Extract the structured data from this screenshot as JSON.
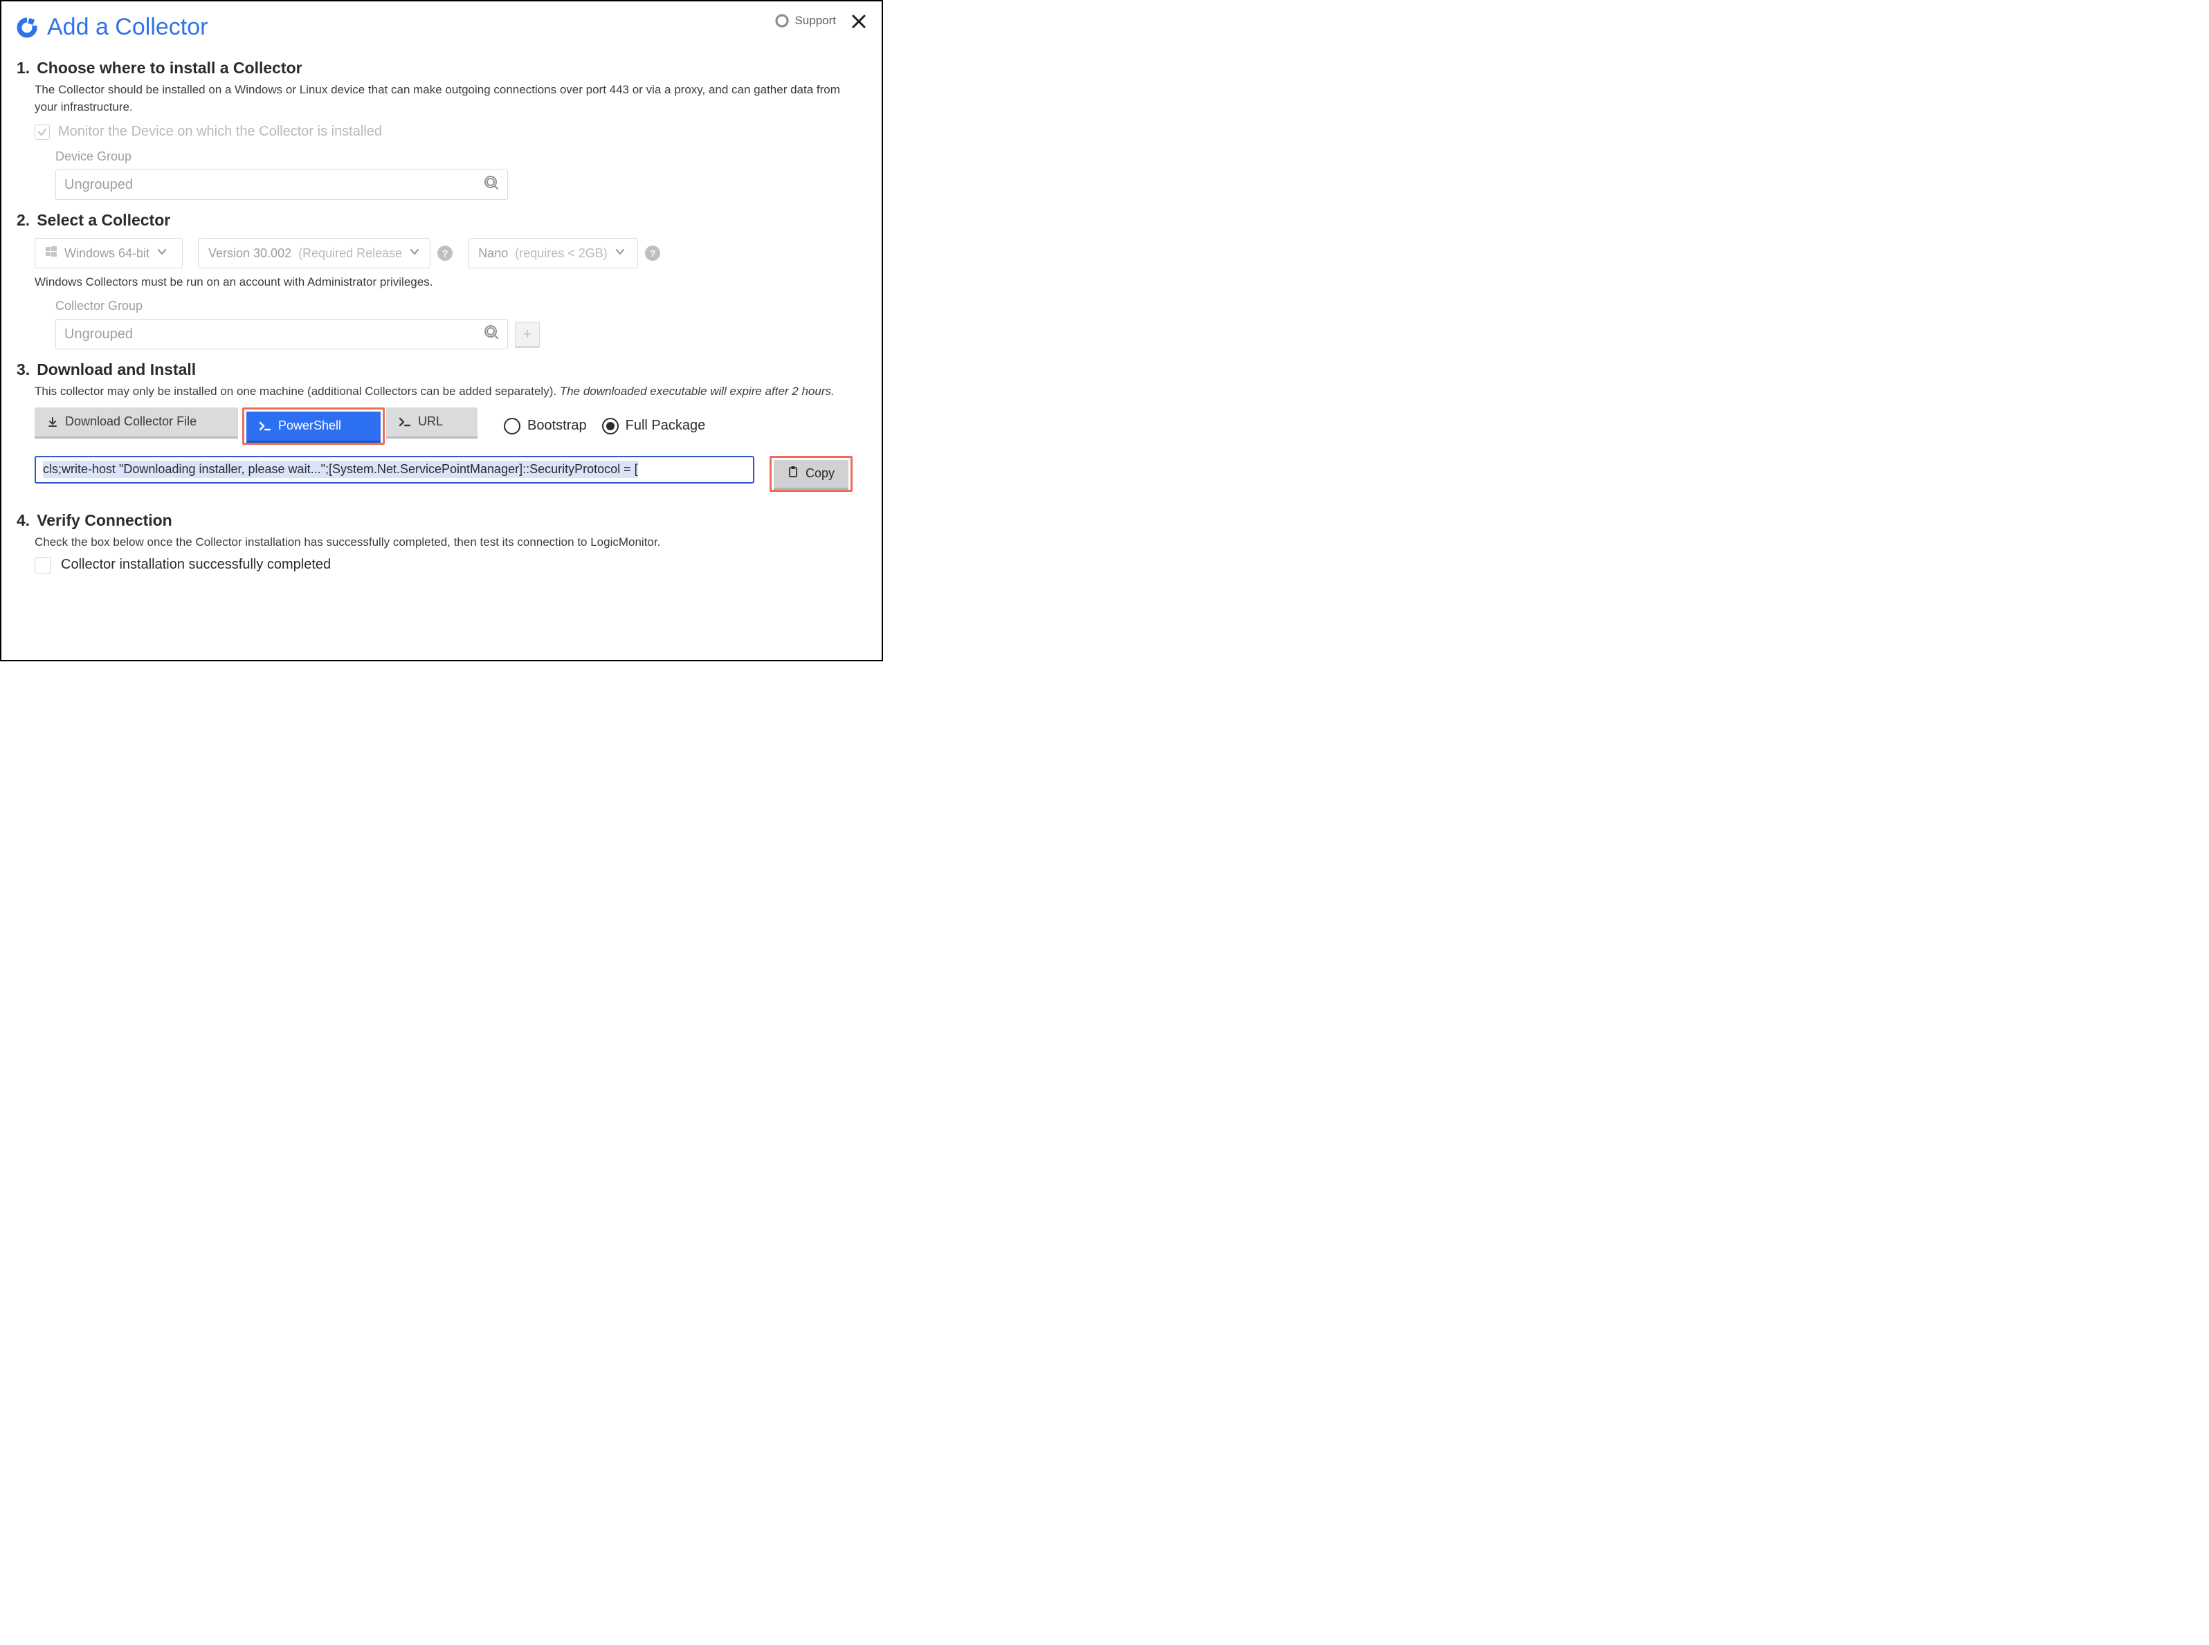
{
  "header": {
    "title": "Add a Collector",
    "support_label": "Support"
  },
  "steps": {
    "s1": {
      "num": "1.",
      "title": "Choose where to install a Collector",
      "desc": "The Collector should be installed on a Windows or Linux device that can make outgoing connections over port 443 or via a proxy, and can gather data from your infrastructure.",
      "monitor_label": "Monitor the Device on which the Collector is installed",
      "device_group_label": "Device Group",
      "device_group_value": "Ungrouped"
    },
    "s2": {
      "num": "2.",
      "title": "Select a Collector",
      "os_label": "Windows 64-bit",
      "version_label_a": "Version 30.002",
      "version_label_b": "(Required Release",
      "size_label_a": "Nano",
      "size_label_b": "(requires < 2GB)",
      "note": "Windows Collectors must be run on an account with Administrator privileges.",
      "collector_group_label": "Collector Group",
      "collector_group_value": "Ungrouped"
    },
    "s3": {
      "num": "3.",
      "title": "Download and Install",
      "desc_plain": "This collector may only be installed on one machine (additional Collectors can be added separately). ",
      "desc_italic": "The downloaded executable will expire after 2 hours.",
      "btn_download": "Download Collector File",
      "btn_powershell": "PowerShell",
      "btn_url": "URL",
      "radio_bootstrap": "Bootstrap",
      "radio_full": "Full Package",
      "command_text": "cls;write-host \"Downloading installer, please wait...\";[System.Net.ServicePointManager]::SecurityProtocol = [",
      "copy_label": "Copy"
    },
    "s4": {
      "num": "4.",
      "title": "Verify Connection",
      "desc": "Check the box below once the Collector installation has successfully completed, then test its connection to LogicMonitor.",
      "check_label": "Collector installation successfully completed"
    }
  },
  "icons": {
    "brand": "brand-icon",
    "support": "support-icon",
    "close": "close-icon",
    "check": "check-icon",
    "magnifier": "magnifier-icon",
    "plus": "plus-icon",
    "windows": "windows-icon",
    "caret": "chevron-down-icon",
    "help": "help-icon",
    "download": "download-icon",
    "terminal": "terminal-icon",
    "clipboard": "clipboard-icon"
  }
}
